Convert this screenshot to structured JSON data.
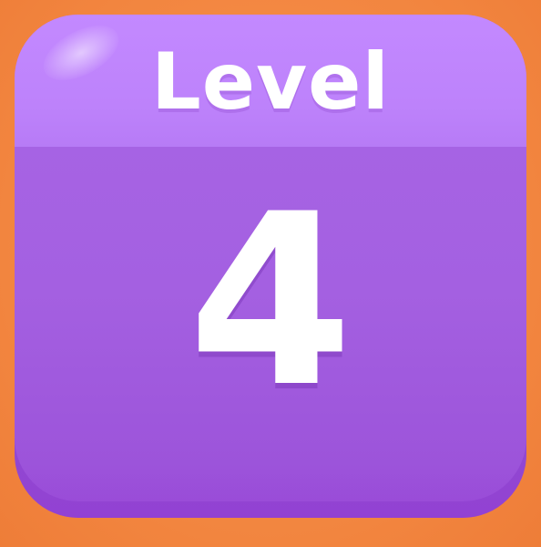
{
  "level_tile": {
    "header_label": "Level",
    "number": "4",
    "colors": {
      "background": "#f2853f",
      "header": "#c389ff",
      "body": "#a460e1",
      "text": "#ffffff"
    }
  }
}
